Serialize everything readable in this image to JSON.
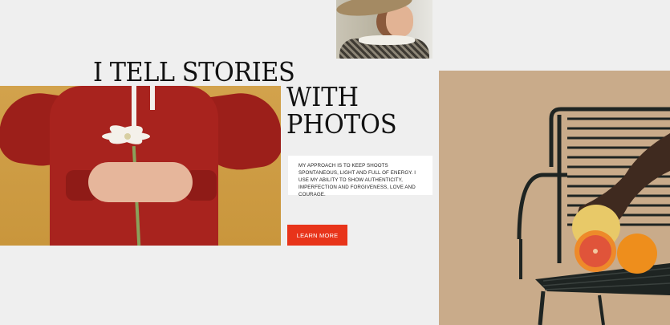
{
  "hero": {
    "title_line1": "I TELL STORIES",
    "title_line2": "WITH",
    "title_line3": "PHOTOS",
    "intro": "MY APPROACH IS TO KEEP SHOOTS SPONTANEOUS, LIGHT AND FULL OF ENERGY. I USE MY ABILITY TO SHOW AUTHENTICITY, IMPERFECTION AND FORGIVENESS, LOVE AND COURAGE.",
    "cta_label": "LEARN MORE"
  },
  "colors": {
    "page_background": "#efefef",
    "accent": "#e8341a",
    "heading": "#111111"
  }
}
